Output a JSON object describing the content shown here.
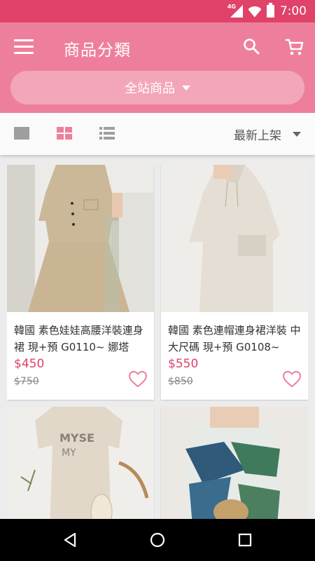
{
  "status": {
    "network": "4G",
    "time": "7:00"
  },
  "header": {
    "title": "商品分類",
    "site_selector": "全站商品"
  },
  "toolbar": {
    "sort_label": "最新上架"
  },
  "products": [
    {
      "name": "韓國 素色娃娃高腰洋裝連身裙 現+預 G0110~ 娜塔",
      "price": "$450",
      "original_price": "$750"
    },
    {
      "name": "韓國 素色連帽連身裙洋裝 中大尺碼 現+預 G0108~",
      "price": "$550",
      "original_price": "$850"
    },
    {
      "name": "",
      "price": "",
      "original_price": ""
    },
    {
      "name": "",
      "price": "",
      "original_price": ""
    }
  ],
  "colors": {
    "status_bar": "#e0426a",
    "app_bar": "#ee7f9c",
    "price": "#e0426a",
    "heart": "#ee7f9c"
  }
}
